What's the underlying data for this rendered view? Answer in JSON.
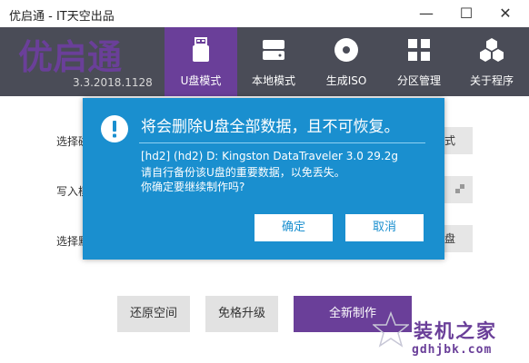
{
  "window": {
    "title": "优启通 - IT天空出品",
    "minimize_glyph": "—",
    "maximize_glyph": "☐",
    "close_glyph": "✕"
  },
  "header": {
    "logo_text": "优启通",
    "version": "3.3.2018.1128",
    "tabs": [
      {
        "label": "U盘模式",
        "icon": "usb-drive-icon",
        "active": true
      },
      {
        "label": "本地模式",
        "icon": "hard-disk-icon",
        "active": false
      },
      {
        "label": "生成ISO",
        "icon": "disc-icon",
        "active": false
      },
      {
        "label": "分区管理",
        "icon": "grid-icon",
        "active": false
      },
      {
        "label": "关于程序",
        "icon": "hexagons-icon",
        "active": false
      }
    ]
  },
  "main": {
    "rows": [
      {
        "label": "选择磁",
        "button": "式"
      },
      {
        "label": "写入模",
        "button": ""
      },
      {
        "label": "选择默",
        "button": "盘"
      }
    ],
    "buttons": {
      "restore": "还原空间",
      "upgrade": "免格升级",
      "create": "全新制作"
    }
  },
  "dialog": {
    "title": "将会删除U盘全部数据，且不可恢复。",
    "device": "[hd2] (hd2) D: Kingston DataTraveler 3.0 29.2g",
    "backup_hint": "请自行备份该U盘的重要数据，以免丢失。",
    "confirm_question": "你确定要继续制作吗?",
    "ok": "确定",
    "cancel": "取消"
  },
  "watermark": {
    "main": "装机之家",
    "url": "gdhjbk.com"
  },
  "colors": {
    "toolbar": "#4a4c57",
    "accent": "#6a3f99",
    "dialog": "#1a8fcf"
  }
}
